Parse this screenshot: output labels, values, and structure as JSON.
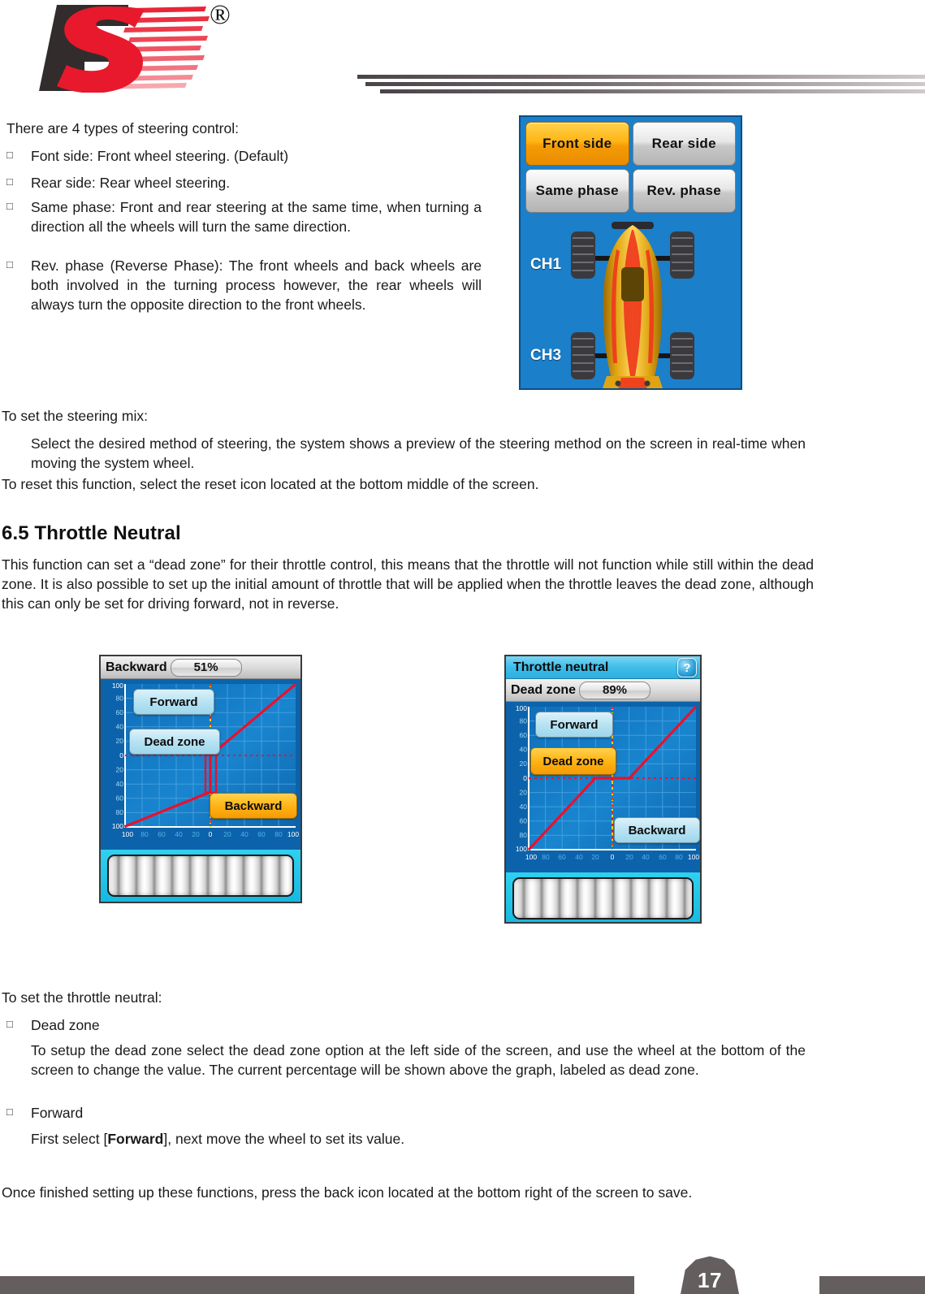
{
  "header": {
    "logo_name": "FS",
    "registered_mark": "®"
  },
  "content": {
    "intro_line": "There are 4 types of steering control:",
    "steering_bullets": [
      "Font side: Front wheel steering. (Default)",
      "Rear side: Rear wheel steering.",
      "Same phase: Front and rear steering at the same time, when turning a direction all the wheels will turn the same direction.",
      "Rev. phase (Reverse Phase): The front wheels and back wheels are both involved in the turning process however, the rear wheels will always turn the opposite direction to the front wheels."
    ],
    "set_steering_mix_label": "To set the steering mix:",
    "set_steering_mix_body": "Select the desired method of steering, the system shows a preview of the steering method on the screen in real-time when moving the system wheel.",
    "reset_note": "To reset this function, select the reset icon located at the bottom middle of the screen.",
    "section_heading": "6.5 Throttle Neutral",
    "section_body": "This function can set a “dead zone” for their throttle control, this means that the throttle will not function while still within the dead zone. It is also possible to set up the initial amount of throttle that will be applied when the throttle leaves the dead zone, although this can only be set for driving forward, not in reverse.",
    "set_throttle_label": "To set the throttle neutral:",
    "throttle_bullets": [
      {
        "title": "Dead zone",
        "body": "To setup the dead zone select the dead zone option at the left side of the screen, and use the wheel at the bottom of the screen to change the value. The current percentage will be shown above the graph, labeled as dead zone."
      },
      {
        "title": "Forward",
        "body_prefix": "First select [",
        "body_bold": "Forward",
        "body_suffix": "], next move the wheel to set its value."
      }
    ],
    "closing_note": "Once finished setting up these functions, press the back icon located at the bottom right of the screen to save.",
    "bullet_glyph": "□"
  },
  "steering_screen": {
    "buttons": [
      {
        "label": "Front side",
        "selected": true
      },
      {
        "label": "Rear side",
        "selected": false
      },
      {
        "label": "Same phase",
        "selected": false
      },
      {
        "label": "Rev. phase",
        "selected": false
      }
    ],
    "channel_labels": {
      "front": "CH1",
      "rear": "CH3"
    },
    "background_color": "#1b7fc9"
  },
  "throttle_screen_1": {
    "value_label": "Backward",
    "value": "51%",
    "buttons": {
      "forward": "Forward",
      "dead_zone": "Dead zone",
      "backward": "Backward"
    },
    "selected_button": "Backward"
  },
  "throttle_screen_2": {
    "title": "Throttle neutral",
    "help_glyph": "?",
    "value_label": "Dead zone",
    "value": "89%",
    "buttons": {
      "forward": "Forward",
      "dead_zone": "Dead zone",
      "backward": "Backward"
    },
    "selected_button": "Dead zone"
  },
  "graph_axes": {
    "y_ticks": [
      "100",
      "80",
      "60",
      "40",
      "20",
      "0",
      "20",
      "40",
      "60",
      "80",
      "100"
    ],
    "x_ticks": [
      "100",
      "80",
      "60",
      "40",
      "20",
      "0",
      "20",
      "40",
      "60",
      "80",
      "100"
    ],
    "curve_color": "#e8112d",
    "grid_color": "#4ba3e0",
    "axis_text_color": "#9fd8f5"
  },
  "footer": {
    "page_number": "17",
    "bar_color": "#645e5e"
  }
}
